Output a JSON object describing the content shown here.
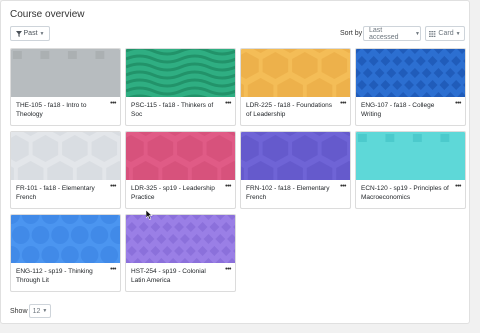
{
  "panel": {
    "title": "Course overview"
  },
  "filter": {
    "label": "Past",
    "icon": "funnel-icon"
  },
  "sort": {
    "label": "Sort by",
    "value": "Last accessed"
  },
  "view": {
    "value": "Card",
    "icon": "grid-icon"
  },
  "courses": [
    {
      "title": "THE-105 - fa18 - Intro to Theology",
      "pattern": "squares",
      "c1": "#b7bcbf",
      "c2": "#a7acaf"
    },
    {
      "title": "PSC-115 - fa18 - Thinkers of Soc",
      "pattern": "waves",
      "c1": "#2fae82",
      "c2": "#22936a"
    },
    {
      "title": "LDR-225 - fa18 - Foundations of Leadership",
      "pattern": "hex",
      "c1": "#f4bd57",
      "c2": "#e7a842"
    },
    {
      "title": "ENG-107 - fa18 - College Writing",
      "pattern": "diamonds",
      "c1": "#2c6fd1",
      "c2": "#1b54b0"
    },
    {
      "title": "FR-101 - fa18 - Elementary French",
      "pattern": "hex",
      "c1": "#e3e6ea",
      "c2": "#d2d6db"
    },
    {
      "title": "LDR-325 - sp19 - Leadership Practice",
      "pattern": "hex",
      "c1": "#e05b86",
      "c2": "#cf4a74"
    },
    {
      "title": "FRN-102 - fa18 - Elementary French",
      "pattern": "hex",
      "c1": "#6f64d6",
      "c2": "#5d52c4"
    },
    {
      "title": "ECN-120 - sp19 - Principles of Macroeconomics",
      "pattern": "squares",
      "c1": "#5ed8d8",
      "c2": "#47c7c9"
    },
    {
      "title": "ENG-112 - sp19 - Thinking Through Lit",
      "pattern": "circles",
      "c1": "#4b95f0",
      "c2": "#3a84e3"
    },
    {
      "title": "HST-254 - sp19 - Colonial Latin America",
      "pattern": "diamonds",
      "c1": "#9a7fe6",
      "c2": "#8569d6"
    }
  ],
  "pagination": {
    "label": "Show",
    "value": "12"
  }
}
